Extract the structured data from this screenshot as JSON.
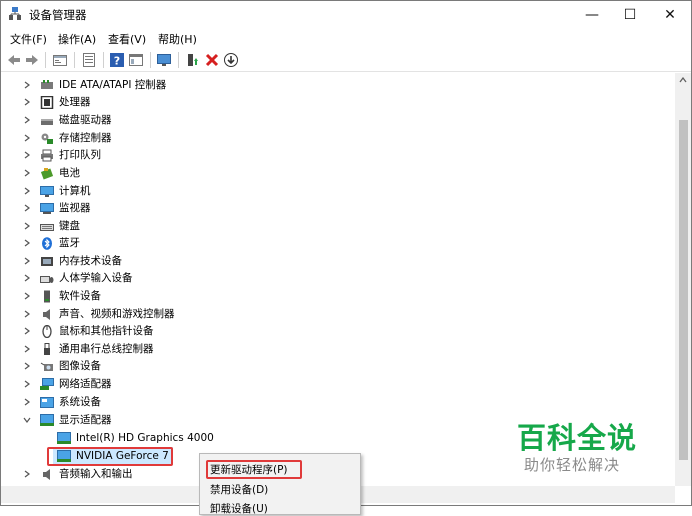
{
  "window": {
    "title": "设备管理器",
    "controls": {
      "minimize": "—",
      "maximize": "☐",
      "close": "✕"
    }
  },
  "menu": [
    "文件(F)",
    "操作(A)",
    "查看(V)",
    "帮助(H)"
  ],
  "toolbar_icons": [
    "back-icon",
    "forward-icon",
    "properties-icon",
    "view-icon",
    "help-icon",
    "panel-icon",
    "monitor-icon",
    "update-driver-icon",
    "uninstall-icon",
    "scan-icon"
  ],
  "tree": [
    {
      "label": "IDE ATA/ATAPI 控制器",
      "icon": "ide-controller-icon",
      "expanded": false
    },
    {
      "label": "处理器",
      "icon": "processor-icon",
      "expanded": false
    },
    {
      "label": "磁盘驱动器",
      "icon": "disk-drive-icon",
      "expanded": false
    },
    {
      "label": "存储控制器",
      "icon": "storage-controller-icon",
      "expanded": false
    },
    {
      "label": "打印队列",
      "icon": "printer-icon",
      "expanded": false
    },
    {
      "label": "电池",
      "icon": "battery-icon",
      "expanded": false
    },
    {
      "label": "计算机",
      "icon": "computer-icon",
      "expanded": false
    },
    {
      "label": "监视器",
      "icon": "monitor-icon",
      "expanded": false
    },
    {
      "label": "键盘",
      "icon": "keyboard-icon",
      "expanded": false
    },
    {
      "label": "蓝牙",
      "icon": "bluetooth-icon",
      "expanded": false
    },
    {
      "label": "内存技术设备",
      "icon": "memory-icon",
      "expanded": false
    },
    {
      "label": "人体学输入设备",
      "icon": "hid-icon",
      "expanded": false
    },
    {
      "label": "软件设备",
      "icon": "software-device-icon",
      "expanded": false
    },
    {
      "label": "声音、视频和游戏控制器",
      "icon": "sound-icon",
      "expanded": false
    },
    {
      "label": "鼠标和其他指针设备",
      "icon": "mouse-icon",
      "expanded": false
    },
    {
      "label": "通用串行总线控制器",
      "icon": "usb-icon",
      "expanded": false
    },
    {
      "label": "图像设备",
      "icon": "camera-icon",
      "expanded": false
    },
    {
      "label": "网络适配器",
      "icon": "network-icon",
      "expanded": false
    },
    {
      "label": "系统设备",
      "icon": "system-icon",
      "expanded": false
    },
    {
      "label": "显示适配器",
      "icon": "display-adapter-icon",
      "expanded": true,
      "children": [
        "Intel(R) HD Graphics 4000",
        "NVIDIA GeForce 7"
      ]
    },
    {
      "label": "音频输入和输出",
      "icon": "audio-icon",
      "expanded": false
    }
  ],
  "context_menu": [
    "更新驱动程序(P)",
    "禁用设备(D)",
    "卸载设备(U)"
  ],
  "watermark": {
    "main": "百科全说",
    "sub": "助你轻松解决"
  },
  "colors": {
    "highlight": "#e03a3a",
    "watermark_green": "#16a84a",
    "selection": "#cce8ff"
  }
}
